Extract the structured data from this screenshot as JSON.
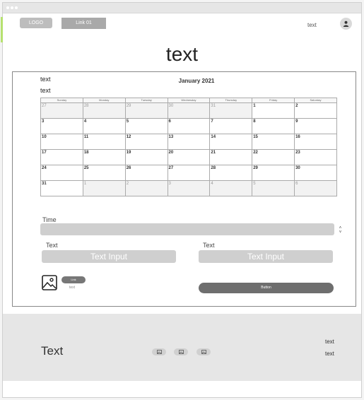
{
  "header": {
    "logo_label": "LOGO",
    "link_label": "Link 01",
    "nav_text": "text"
  },
  "page_title": "text",
  "calendar": {
    "side_text_1": "text",
    "side_text_2": "text",
    "month_label": "January 2021",
    "weekdays": [
      "Sunday",
      "Monday",
      "Tuesday",
      "Wednesday",
      "Thursday",
      "Friday",
      "Saturday"
    ],
    "weeks": [
      [
        "27",
        "28",
        "29",
        "30",
        "31",
        "1",
        "2"
      ],
      [
        "3",
        "4",
        "5",
        "6",
        "7",
        "8",
        "9"
      ],
      [
        "10",
        "11",
        "12",
        "13",
        "14",
        "15",
        "16"
      ],
      [
        "17",
        "18",
        "19",
        "20",
        "21",
        "22",
        "23"
      ],
      [
        "24",
        "25",
        "26",
        "27",
        "28",
        "29",
        "30"
      ],
      [
        "31",
        "1",
        "2",
        "3",
        "4",
        "5",
        "6"
      ]
    ],
    "muted": [
      [
        true,
        true,
        true,
        true,
        true,
        false,
        false
      ],
      [
        false,
        false,
        false,
        false,
        false,
        false,
        false
      ],
      [
        false,
        false,
        false,
        false,
        false,
        false,
        false
      ],
      [
        false,
        false,
        false,
        false,
        false,
        false,
        false
      ],
      [
        false,
        false,
        false,
        false,
        false,
        false,
        false
      ],
      [
        false,
        true,
        true,
        true,
        true,
        true,
        true
      ]
    ]
  },
  "form": {
    "time_label": "Time",
    "time_value": "",
    "left_label": "Text",
    "left_input_placeholder": "Text Input",
    "right_label": "Text",
    "right_input_placeholder": "Text Input",
    "pill_label": "Link",
    "pill_sub_text": "text",
    "button_label": "Button"
  },
  "footer": {
    "title": "Text",
    "text_1": "text",
    "text_2": "text"
  }
}
